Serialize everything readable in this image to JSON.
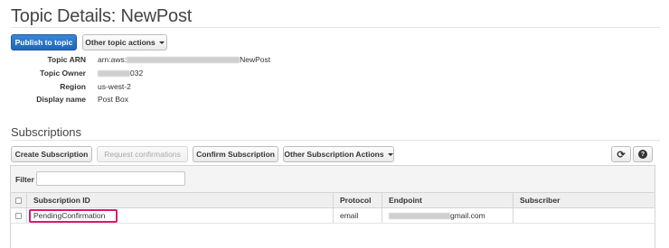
{
  "page": {
    "title": "Topic Details: NewPost"
  },
  "actions": {
    "publish_label": "Publish to topic",
    "other_topic_actions_label": "Other topic actions"
  },
  "details": [
    {
      "label": "Topic ARN",
      "value_prefix": "arn:aws:",
      "value_suffix": "NewPost"
    },
    {
      "label": "Topic Owner",
      "value_prefix": "",
      "value_suffix": "032"
    },
    {
      "label": "Region",
      "value_prefix": "us-west-2",
      "value_suffix": ""
    },
    {
      "label": "Display name",
      "value_prefix": "Post Box",
      "value_suffix": ""
    }
  ],
  "subscriptions": {
    "title": "Subscriptions",
    "buttons": {
      "create": "Create Subscription",
      "request": "Request confirmations",
      "confirm": "Confirm Subscription",
      "other": "Other Subscription Actions"
    },
    "icons": {
      "refresh": "⟳",
      "help": "?"
    },
    "filter": {
      "label": "Filter",
      "value": ""
    },
    "columns": [
      "Subscription ID",
      "Protocol",
      "Endpoint",
      "Subscriber"
    ],
    "rows": [
      {
        "subscription_id": "PendingConfirmation",
        "protocol": "email",
        "endpoint_suffix": "gmail.com",
        "subscriber": ""
      }
    ],
    "highlight_color": "#e0196f"
  },
  "colors": {
    "primary": "#2a76c6",
    "border": "#d5d5d5"
  }
}
